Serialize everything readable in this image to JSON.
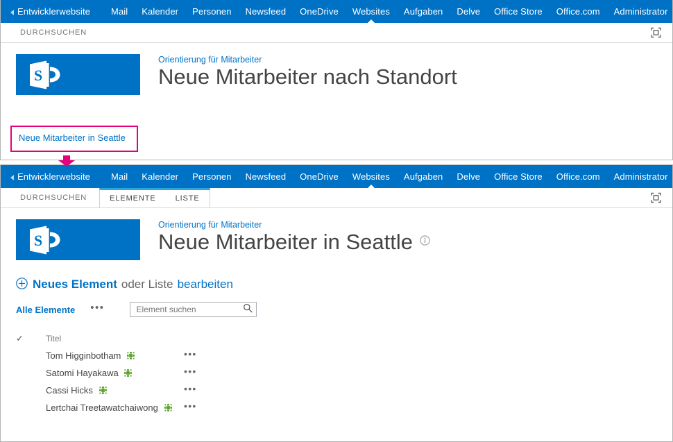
{
  "suite_nav": {
    "home_label": "Entwicklerwebsite",
    "back_icon": "back-triangle-icon",
    "links": [
      {
        "label": "Mail",
        "active": false
      },
      {
        "label": "Kalender",
        "active": false
      },
      {
        "label": "Personen",
        "active": false
      },
      {
        "label": "Newsfeed",
        "active": false
      },
      {
        "label": "OneDrive",
        "active": false
      },
      {
        "label": "Websites",
        "active": true
      },
      {
        "label": "Aufgaben",
        "active": false
      },
      {
        "label": "Delve",
        "active": false
      },
      {
        "label": "Office Store",
        "active": false
      },
      {
        "label": "Office.com",
        "active": false
      }
    ],
    "account_label": "Administrator",
    "account_caret_icon": "chevron-down-icon",
    "help_label": "?",
    "help_icon": "help-question-icon"
  },
  "colors": {
    "suite_blue": "#0072c6",
    "link_blue": "#0072c6",
    "highlight_magenta": "#e5007e",
    "tab_active_top": "#2ea5dd",
    "new_badge_green": "#54a021",
    "text_gray": "#444444",
    "muted_gray": "#767676"
  },
  "panel_top": {
    "tabs": [
      {
        "label": "DURCHSUCHEN",
        "grouped": false
      }
    ],
    "focus_icon": "focus-on-content-icon",
    "logo_icon": "sharepoint-logo-icon",
    "breadcrumb": "Orientierung für Mitarbeiter",
    "page_title": "Neue Mitarbeiter nach Standort",
    "callout_link": "Neue Mitarbeiter in Seattle",
    "callout_arrow_icon": "down-arrow-annotation-icon"
  },
  "panel_bottom": {
    "tabs": [
      {
        "label": "DURCHSUCHEN",
        "grouped": false
      },
      {
        "label": "ELEMENTE",
        "grouped": true
      },
      {
        "label": "LISTE",
        "grouped": true
      }
    ],
    "focus_icon": "focus-on-content-icon",
    "logo_icon": "sharepoint-logo-icon",
    "breadcrumb": "Orientierung für Mitarbeiter",
    "page_title": "Neue Mitarbeiter in Seattle",
    "title_info_icon": "info-circle-icon",
    "new_item": {
      "plus_icon": "plus-circle-icon",
      "new_label": "Neues Element",
      "or_label": "oder Liste",
      "edit_label": "bearbeiten"
    },
    "toolbar": {
      "view_label": "Alle Elemente",
      "more_label": "•••",
      "search_placeholder": "Element suchen",
      "search_value": "",
      "search_icon": "search-magnifier-icon"
    },
    "list": {
      "header_check_icon": "checkmark-icon",
      "columns": [
        "Titel"
      ],
      "rows": [
        {
          "title": "Tom Higginbotham",
          "badge_icon": "new-item-sparkle-icon",
          "menu_label": "•••"
        },
        {
          "title": "Satomi Hayakawa",
          "badge_icon": "new-item-sparkle-icon",
          "menu_label": "•••"
        },
        {
          "title": "Cassi Hicks",
          "badge_icon": "new-item-sparkle-icon",
          "menu_label": "•••"
        },
        {
          "title": "Lertchai Treetawatchaiwong",
          "badge_icon": "new-item-sparkle-icon",
          "menu_label": "•••"
        }
      ]
    }
  }
}
